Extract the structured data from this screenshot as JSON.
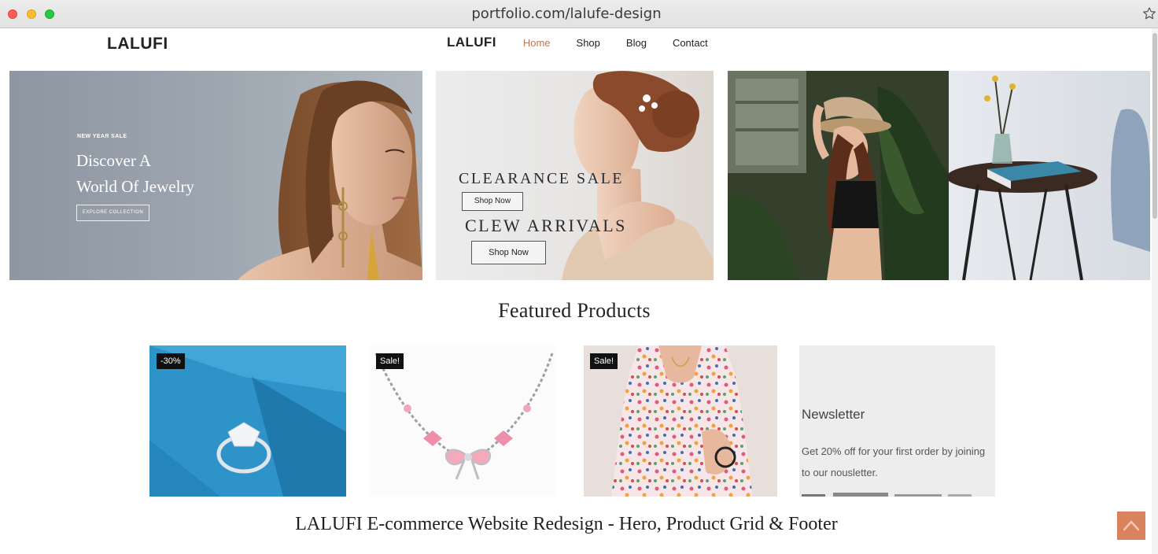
{
  "browser": {
    "url": "portfolio.com/lalufe-design",
    "icons": [
      "close-dot",
      "minimize-dot",
      "zoom-dot",
      "bookmark-star-icon"
    ]
  },
  "header": {
    "logo_left": "LALUFI",
    "nav_logo": "LALUFI",
    "nav": [
      {
        "label": "Home",
        "active": true
      },
      {
        "label": "Shop",
        "active": false
      },
      {
        "label": "Blog",
        "active": false
      },
      {
        "label": "Contact",
        "active": false
      }
    ]
  },
  "hero": {
    "banner1": {
      "tag": "NEW YEAR SALE",
      "title_line1": "Discover A",
      "title_line2": "World Of Jewelry",
      "button": "EXPLORE COLLECTION"
    },
    "banner2": {
      "title1": "CLEARANCE SALE",
      "button1": "Shop Now",
      "title2": "CLEW ARRIVALS",
      "button2": "Shop Now"
    }
  },
  "featured": {
    "title": "Featured Products",
    "products": [
      {
        "badge": "-30%",
        "image": "diamond-ring"
      },
      {
        "badge": "Sale!",
        "image": "pink-bow-necklace"
      },
      {
        "badge": "Sale!",
        "image": "floral-dress"
      }
    ],
    "newsletter": {
      "title": "Newsletter",
      "body": "Get 20% off for your first order by joining to our nousletter."
    }
  },
  "caption": "LALUFI E-commerce Website Redesign - Hero, Product Grid & Footer",
  "colors": {
    "accent": "#d9825e",
    "nav_active": "#b77a5a",
    "badge_bg": "#111111"
  }
}
